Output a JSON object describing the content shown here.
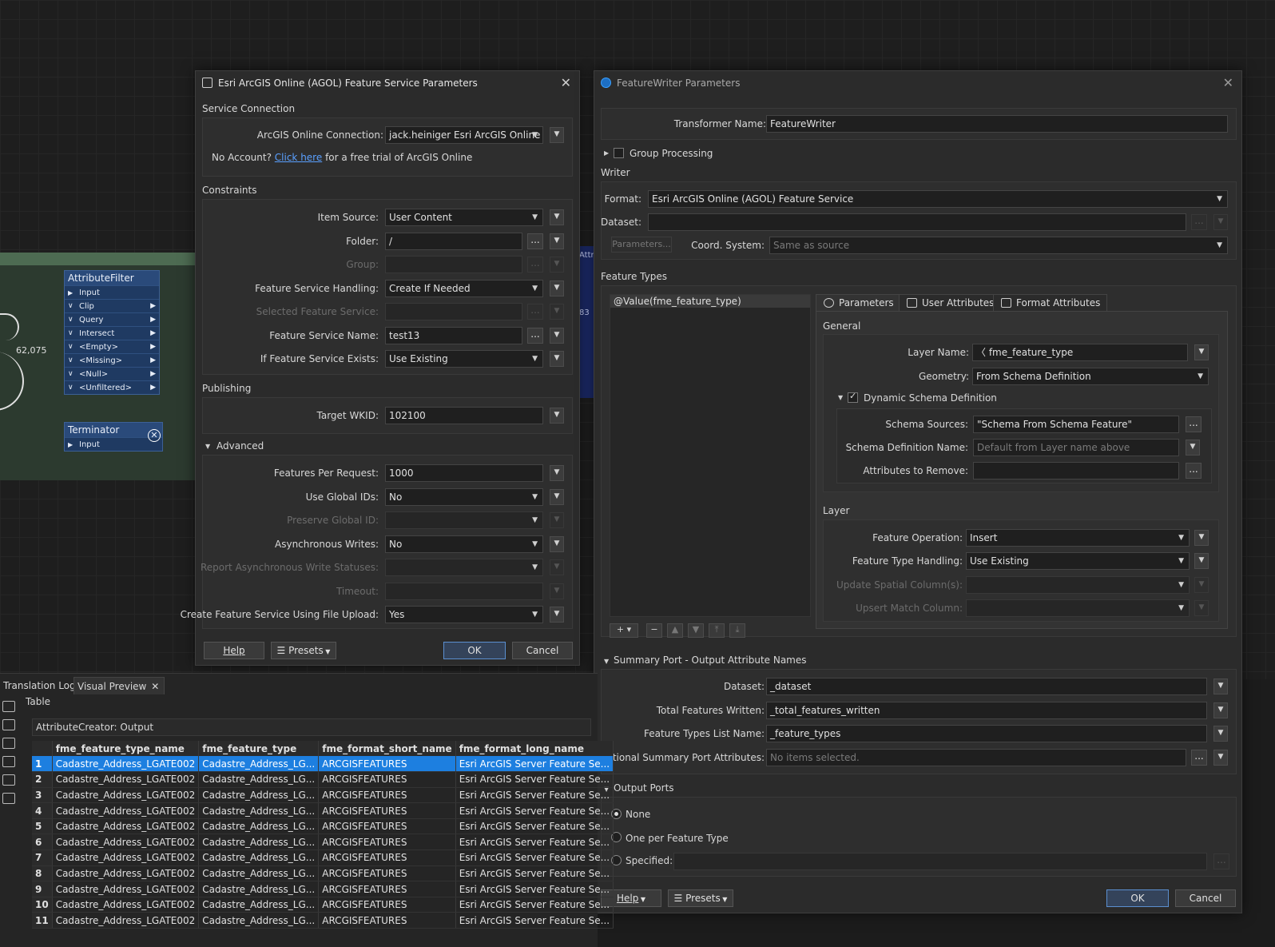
{
  "canvas": {
    "attribute_filter": {
      "title": "AttributeFilter",
      "ports": [
        "Input",
        "Clip",
        "Query",
        "Intersect",
        "<Empty>",
        "<Missing>",
        "<Null>",
        "<Unfiltered>"
      ]
    },
    "terminator": {
      "title": "Terminator",
      "port": "Input"
    },
    "feature_count": "62,075",
    "partial_label": "Attri",
    "partial_count": "83"
  },
  "agol": {
    "title": "Esri ArcGIS Online (AGOL) Feature Service Parameters",
    "service_connection_label": "Service Connection",
    "connection_label": "ArcGIS Online Connection:",
    "connection_value": "jack.heiniger Esri ArcGIS Online",
    "no_account_text": "No Account?",
    "click_here": "Click here",
    "trial_text": "for a free trial of ArcGIS Online",
    "constraints_label": "Constraints",
    "item_source_label": "Item Source:",
    "item_source_value": "User Content",
    "folder_label": "Folder:",
    "folder_value": "/",
    "group_label": "Group:",
    "fs_handling_label": "Feature Service Handling:",
    "fs_handling_value": "Create If Needed",
    "selected_fs_label": "Selected Feature Service:",
    "fs_name_label": "Feature Service Name:",
    "fs_name_value": "test13",
    "fs_exists_label": "If Feature Service Exists:",
    "fs_exists_value": "Use Existing",
    "publishing_label": "Publishing",
    "wkid_label": "Target WKID:",
    "wkid_value": "102100",
    "advanced_label": "Advanced",
    "fpr_label": "Features Per Request:",
    "fpr_value": "1000",
    "global_ids_label": "Use Global IDs:",
    "global_ids_value": "No",
    "preserve_gid_label": "Preserve Global ID:",
    "async_label": "Asynchronous Writes:",
    "async_value": "No",
    "report_async_label": "Report Asynchronous Write Statuses:",
    "timeout_label": "Timeout:",
    "file_upload_label": "Create Feature Service Using File Upload:",
    "file_upload_value": "Yes",
    "help": "Help",
    "presets": "Presets",
    "ok": "OK",
    "cancel": "Cancel"
  },
  "fw": {
    "title": "FeatureWriter Parameters",
    "transformer_name_label": "Transformer Name:",
    "transformer_name_value": "FeatureWriter",
    "group_processing": "Group Processing",
    "writer_label": "Writer",
    "format_label": "Format:",
    "format_value": "Esri ArcGIS Online (AGOL) Feature Service",
    "dataset_label": "Dataset:",
    "parameters_btn": "Parameters...",
    "coord_label": "Coord. System:",
    "coord_value": "Same as source",
    "feature_types_label": "Feature Types",
    "feature_type_item": "@Value(fme_feature_type)",
    "tabs": [
      "Parameters",
      "User Attributes",
      "Format Attributes"
    ],
    "general_label": "General",
    "layer_name_label": "Layer Name:",
    "layer_name_value": "fme_feature_type",
    "geometry_label": "Geometry:",
    "geometry_value": "From Schema Definition",
    "dynamic_schema": "Dynamic Schema Definition",
    "schema_sources_label": "Schema Sources:",
    "schema_sources_value": "\"Schema From Schema Feature\"",
    "schema_def_name_label": "Schema Definition Name:",
    "schema_def_name_placeholder": "Default from Layer name above",
    "attrs_remove_label": "Attributes to Remove:",
    "layer_label": "Layer",
    "feature_op_label": "Feature Operation:",
    "feature_op_value": "Insert",
    "ft_handling_label": "Feature Type Handling:",
    "ft_handling_value": "Use Existing",
    "update_spatial_label": "Update Spatial Column(s):",
    "upsert_label": "Upsert Match Column:",
    "summary_label": "Summary Port - Output Attribute Names",
    "sum_dataset_label": "Dataset:",
    "sum_dataset_value": "_dataset",
    "total_written_label": "Total Features Written:",
    "total_written_value": "_total_features_written",
    "ft_list_label": "Feature Types List Name:",
    "ft_list_value": "_feature_types",
    "additional_label": "Additional Summary Port Attributes:",
    "additional_placeholder": "No items selected.",
    "output_ports_label": "Output Ports",
    "radio_none": "None",
    "radio_one_per": "One per Feature Type",
    "radio_specified": "Specified:",
    "help": "Help",
    "presets": "Presets",
    "ok": "OK",
    "cancel": "Cancel"
  },
  "preview": {
    "tab_log": "Translation Log",
    "tab_visual": "Visual Preview",
    "view_label": "Table",
    "source_label": "AttributeCreator: Output",
    "columns": [
      "fme_feature_type_name",
      "fme_feature_type",
      "fme_format_short_name",
      "fme_format_long_name"
    ],
    "rows": [
      [
        "1",
        "Cadastre_Address_LGATE002",
        "Cadastre_Address_LG...",
        "ARCGISFEATURES",
        "Esri ArcGIS Server Feature Se..."
      ],
      [
        "2",
        "Cadastre_Address_LGATE002",
        "Cadastre_Address_LG...",
        "ARCGISFEATURES",
        "Esri ArcGIS Server Feature Se..."
      ],
      [
        "3",
        "Cadastre_Address_LGATE002",
        "Cadastre_Address_LG...",
        "ARCGISFEATURES",
        "Esri ArcGIS Server Feature Se..."
      ],
      [
        "4",
        "Cadastre_Address_LGATE002",
        "Cadastre_Address_LG...",
        "ARCGISFEATURES",
        "Esri ArcGIS Server Feature Se..."
      ],
      [
        "5",
        "Cadastre_Address_LGATE002",
        "Cadastre_Address_LG...",
        "ARCGISFEATURES",
        "Esri ArcGIS Server Feature Se..."
      ],
      [
        "6",
        "Cadastre_Address_LGATE002",
        "Cadastre_Address_LG...",
        "ARCGISFEATURES",
        "Esri ArcGIS Server Feature Se..."
      ],
      [
        "7",
        "Cadastre_Address_LGATE002",
        "Cadastre_Address_LG...",
        "ARCGISFEATURES",
        "Esri ArcGIS Server Feature Se..."
      ],
      [
        "8",
        "Cadastre_Address_LGATE002",
        "Cadastre_Address_LG...",
        "ARCGISFEATURES",
        "Esri ArcGIS Server Feature Se..."
      ],
      [
        "9",
        "Cadastre_Address_LGATE002",
        "Cadastre_Address_LG...",
        "ARCGISFEATURES",
        "Esri ArcGIS Server Feature Se..."
      ],
      [
        "10",
        "Cadastre_Address_LGATE002",
        "Cadastre_Address_LG...",
        "ARCGISFEATURES",
        "Esri ArcGIS Server Feature Se..."
      ],
      [
        "11",
        "Cadastre_Address_LGATE002",
        "Cadastre_Address_LG...",
        "ARCGISFEATURES",
        "Esri ArcGIS Server Feature Se..."
      ]
    ]
  }
}
